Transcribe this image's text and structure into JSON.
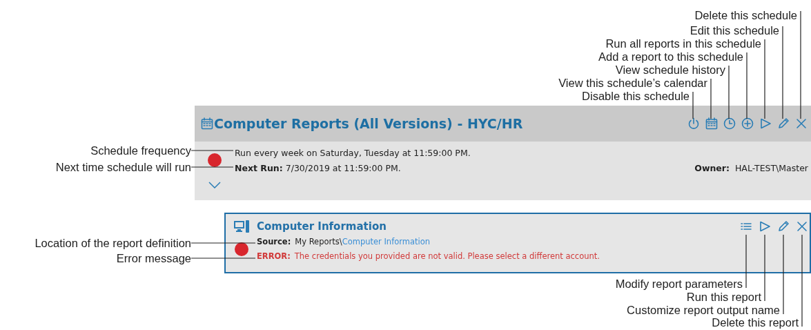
{
  "callouts_top": [
    "Delete this schedule",
    "Edit this schedule",
    "Run all reports in this schedule",
    "Add a report to this schedule",
    "View schedule history",
    "View this schedule’s calendar",
    "Disable this schedule"
  ],
  "schedule": {
    "title": "Computer Reports (All Versions) - HYC/HR",
    "frequency": "Run every week on Saturday, Tuesday at 11:59:00 PM.",
    "next_run_label": "Next Run:",
    "next_run": "7/30/2019 at 11:59:00 PM.",
    "owner_label": "Owner:",
    "owner": "HAL-TEST\\Master"
  },
  "callouts_left": [
    "Schedule frequency",
    "Next time schedule will run",
    "Location of the report definition",
    "Error message"
  ],
  "report": {
    "title": "Computer Information",
    "source_label": "Source:",
    "source_folder": "My Reports\\",
    "source_link": "Computer Information",
    "error_label": "ERROR:",
    "error": "The credentials you provided are not valid. Please select a different account."
  },
  "callouts_bottom": [
    "Modify report parameters",
    "Run this report",
    "Customize report output name",
    "Delete this report"
  ]
}
